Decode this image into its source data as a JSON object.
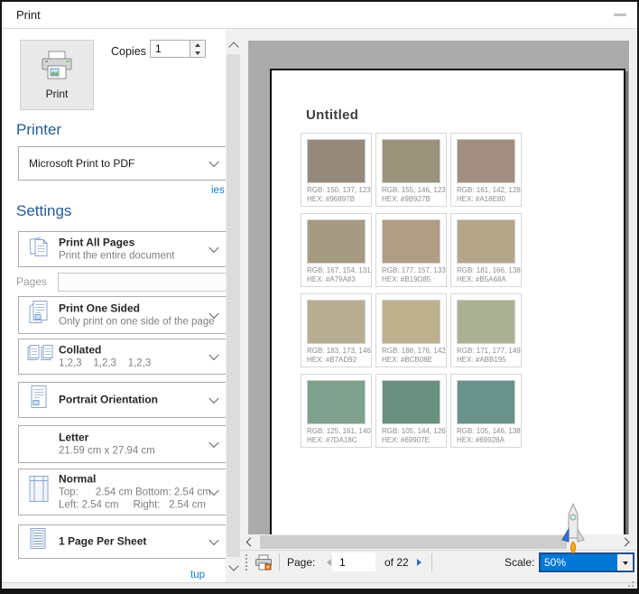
{
  "window": {
    "title": "Print"
  },
  "left": {
    "print_button_label": "Print",
    "copies_label": "Copies",
    "copies_value": "1",
    "printer_heading": "Printer",
    "printer_value": "Microsoft Print to PDF",
    "printer_properties_link_clipped": "ies",
    "settings_heading": "Settings",
    "pages_label": "Pages",
    "pages_value": "",
    "page_setup_link_clipped": "tup",
    "items": [
      {
        "title": "Print All Pages",
        "subtitle": "Print the entire document"
      },
      {
        "title": "Print One Sided",
        "subtitle": "Only print on one side of the page"
      },
      {
        "title": "Collated",
        "subtitle": "1,2,3    1,2,3    1,2,3"
      },
      {
        "title": "Portrait Orientation",
        "subtitle": ""
      },
      {
        "title": "Letter",
        "subtitle": "21.59 cm x 27.94 cm"
      },
      {
        "title": "Normal",
        "margins_line1": "Top:      2.54 cm Bottom: 2.54 cm",
        "margins_line2": "Left: 2.54 cm     Right:   2.54 cm"
      },
      {
        "title": "1 Page Per Sheet",
        "subtitle": ""
      }
    ]
  },
  "preview": {
    "document_title": "Untitled",
    "swatches": [
      {
        "color": "#96897B",
        "rgb": "RGB: 150, 137, 123",
        "hex": "HEX: #96897B"
      },
      {
        "color": "#9B927B",
        "rgb": "RGB: 155, 146, 123",
        "hex": "HEX: #9B927B"
      },
      {
        "color": "#A18E80",
        "rgb": "RGB: 161, 142, 128",
        "hex": "HEX: #A18E80"
      },
      {
        "color": "#A79A83",
        "rgb": "RGB: 167, 154, 131",
        "hex": "HEX: #A79A83"
      },
      {
        "color": "#B19D85",
        "rgb": "RGB: 177, 157, 133",
        "hex": "HEX: #B19D85"
      },
      {
        "color": "#B5A68A",
        "rgb": "RGB: 181, 166, 138",
        "hex": "HEX: #B5A68A"
      },
      {
        "color": "#B7AD92",
        "rgb": "RGB: 183, 173, 146",
        "hex": "HEX: #B7AD92"
      },
      {
        "color": "#BCB08E",
        "rgb": "RGB: 188, 176, 142",
        "hex": "HEX: #BCB08E"
      },
      {
        "color": "#ABB195",
        "rgb": "RGB: 171, 177, 149",
        "hex": "HEX: #ABB195"
      },
      {
        "color": "#7DA18C",
        "rgb": "RGB: 125, 161, 140",
        "hex": "HEX: #7DA18C"
      },
      {
        "color": "#69907E",
        "rgb": "RGB: 105, 144, 126",
        "hex": "HEX: #69907E"
      },
      {
        "color": "#69928A",
        "rgb": "RGB: 105, 146, 138",
        "hex": "HEX: #69928A"
      }
    ]
  },
  "toolbar": {
    "page_label": "Page:",
    "page_value": "1",
    "of_label": "of 22",
    "scale_label": "Scale:",
    "scale_value": "50%"
  },
  "colors": {
    "accent_heading_blue": "#1f5b99",
    "link_blue": "#177ad2",
    "selection_blue": "#0078d7",
    "preview_background_gray": "#ababab",
    "pane_gray": "#f0f0f0"
  }
}
